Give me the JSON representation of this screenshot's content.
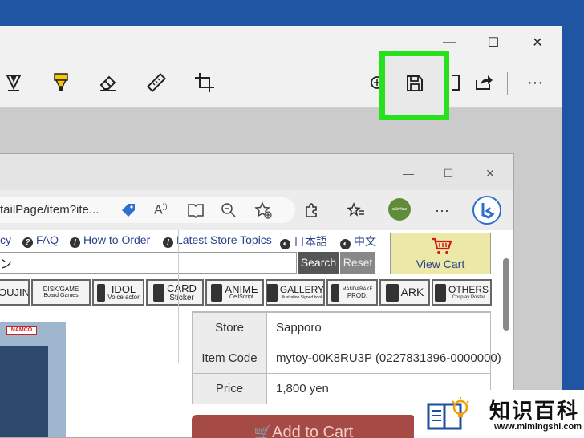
{
  "snip": {
    "window_controls": {
      "minimize": "—",
      "maximize": "☐",
      "close": "✕"
    },
    "toolbar": {
      "tools": [
        "ballpoint-pen-icon",
        "highlighter-icon",
        "eraser-icon",
        "ruler-icon",
        "crop-icon",
        "zoom-icon",
        "save-icon",
        "copy-icon",
        "share-icon"
      ],
      "more": "···",
      "highlight_color": "#27e11c"
    }
  },
  "browser": {
    "window_controls": {
      "minimize": "—",
      "maximize": "☐",
      "close": "✕"
    },
    "url": "tailPage/item?ite...",
    "more": "···",
    "profile": "wikiHow"
  },
  "page": {
    "links": {
      "policy": "cy",
      "faq": "FAQ",
      "how_to_order": "How to Order",
      "latest_store_topics": "Latest Store Topics",
      "japanese": "日本語",
      "chinese": "中文"
    },
    "search_value": "ン",
    "search_button": "Search",
    "reset_button": "Reset",
    "view_cart": "View Cart",
    "categories": [
      {
        "big": "OUJIN",
        "small": ""
      },
      {
        "big": "DISK/GAME",
        "small": "Board Games"
      },
      {
        "big": "IDOL",
        "small": "Voice actor"
      },
      {
        "big": "CARD",
        "small": "Sticker"
      },
      {
        "big": "ANIME",
        "small": "CellScript"
      },
      {
        "big": "GALLERY",
        "small": "Illustration Signed book"
      },
      {
        "big": "MANDARAKE",
        "small": "PROD."
      },
      {
        "big": "ARK",
        "small": ""
      },
      {
        "big": "OTHERS",
        "small": "Cosplay Poster"
      }
    ],
    "product_logo": "NAMCO",
    "details": [
      {
        "label": "Store",
        "value": "Sapporo"
      },
      {
        "label": "Item Code",
        "value": "mytoy-00K8RU3P (0227831396-0000000)"
      },
      {
        "label": "Price",
        "value": "1,800 yen"
      }
    ],
    "add_to_cart": "Add to Cart"
  },
  "watermark": {
    "title": "知识百科",
    "url": "www.mimingshi.com"
  }
}
